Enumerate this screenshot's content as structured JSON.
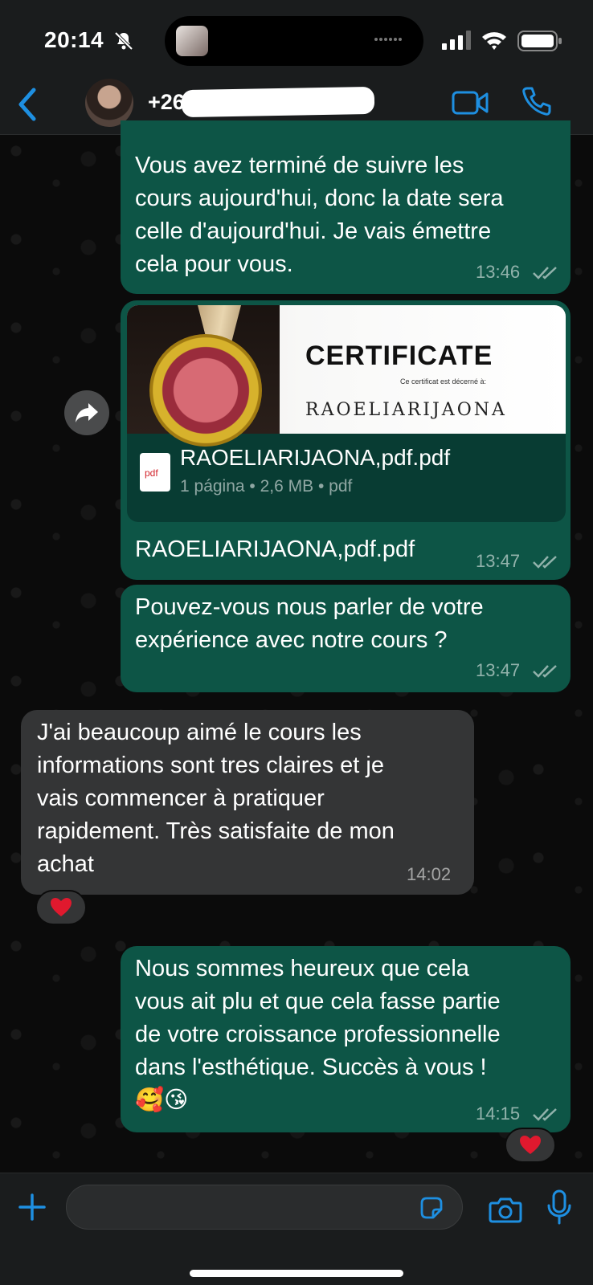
{
  "status_bar": {
    "time": "20:14"
  },
  "header": {
    "contact_number": "+262"
  },
  "messages": [
    {
      "type": "outgoing",
      "text": "Vous avez terminé de suivre les\ncours aujourd'hui, donc la date sera\ncelle d'aujourd'hui. Je vais émettre\ncela pour vous.",
      "time": "13:46"
    },
    {
      "type": "outgoing_file",
      "preview": {
        "title": "CERTIFICATE",
        "subtitle": "Ce certificat est décerné à:",
        "name": "RAOELIARIJAONA"
      },
      "pdf_badge": "pdf",
      "file_name": "RAOELIARIJAONA,pdf.pdf",
      "file_meta": "1 página • 2,6 MB • pdf",
      "caption": "RAOELIARIJAONA,pdf.pdf",
      "time": "13:47"
    },
    {
      "type": "outgoing",
      "text": "Pouvez-vous nous parler de votre\nexpérience avec notre cours ?",
      "time": "13:47"
    },
    {
      "type": "incoming",
      "text": "J'ai beaucoup aimé le cours les\ninformations sont tres claires et je\nvais commencer à pratiquer\nrapidement. Très satisfaite de mon\nachat",
      "time": "14:02",
      "reaction": "heart"
    },
    {
      "type": "outgoing",
      "text": "Nous sommes heureux que cela\nvous ait plu et que cela fasse partie\nde votre croissance professionnelle\ndans l'esthétique. Succès à vous !\n🥰😘",
      "time": "14:15",
      "reaction": "heart"
    }
  ],
  "colors": {
    "outgoing_bubble": "#0d5546",
    "incoming_bubble": "#343536",
    "accent": "#1e8fe1"
  }
}
